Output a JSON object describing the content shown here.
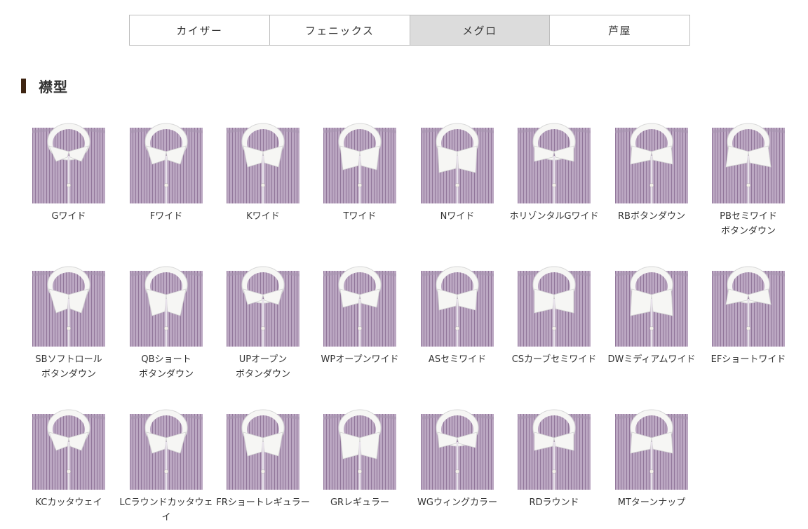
{
  "tabs": [
    {
      "label": "カイザー",
      "active": false
    },
    {
      "label": "フェニックス",
      "active": false
    },
    {
      "label": "メグロ",
      "active": true
    },
    {
      "label": "芦屋",
      "active": false
    }
  ],
  "section": {
    "title": "襟型"
  },
  "colors": {
    "shirt_base": "#bba7c2",
    "shirt_stripe": "#6f4f7a",
    "collar": "#f6f6f4",
    "tab_active_bg": "#dcdcdc",
    "section_bar": "#3e2512"
  },
  "collars": [
    {
      "line1": "Gワイド",
      "line2": ""
    },
    {
      "line1": "Fワイド",
      "line2": ""
    },
    {
      "line1": "Kワイド",
      "line2": ""
    },
    {
      "line1": "Tワイド",
      "line2": ""
    },
    {
      "line1": "Nワイド",
      "line2": ""
    },
    {
      "line1": "ホリゾンタルGワイド",
      "line2": ""
    },
    {
      "line1": "RBボタンダウン",
      "line2": ""
    },
    {
      "line1": "PBセミワイド",
      "line2": "ボタンダウン"
    },
    {
      "line1": "SBソフトロール",
      "line2": "ボタンダウン"
    },
    {
      "line1": "QBショート",
      "line2": "ボタンダウン"
    },
    {
      "line1": "UPオープン",
      "line2": "ボタンダウン"
    },
    {
      "line1": "WPオープンワイド",
      "line2": ""
    },
    {
      "line1": "ASセミワイド",
      "line2": ""
    },
    {
      "line1": "CSカーブセミワイド",
      "line2": ""
    },
    {
      "line1": "DWミディアムワイド",
      "line2": ""
    },
    {
      "line1": "EFショートワイド",
      "line2": ""
    },
    {
      "line1": "KCカッタウェイ",
      "line2": ""
    },
    {
      "line1": "LCラウンドカッタウェイ",
      "line2": ""
    },
    {
      "line1": "FRショートレギュラー",
      "line2": ""
    },
    {
      "line1": "GRレギュラー",
      "line2": ""
    },
    {
      "line1": "WGウィングカラー",
      "line2": ""
    },
    {
      "line1": "RDラウンド",
      "line2": ""
    },
    {
      "line1": "MTターンナップ",
      "line2": ""
    }
  ]
}
